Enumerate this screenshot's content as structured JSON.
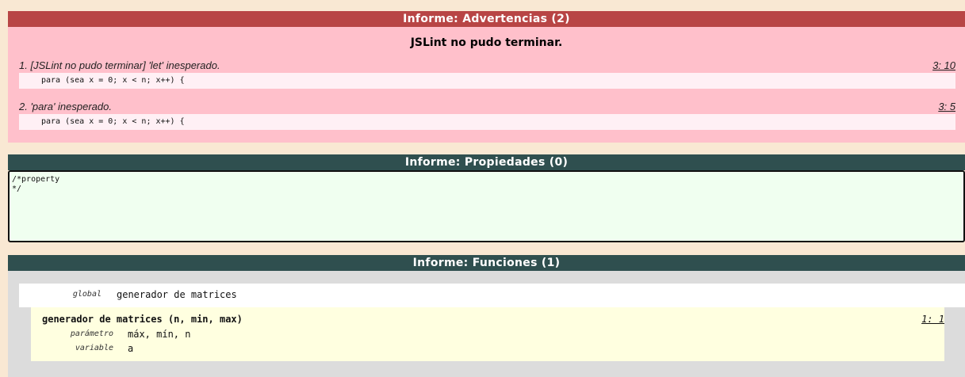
{
  "warnings": {
    "header": "Informe: Advertencias (2)",
    "title": "JSLint no pudo terminar.",
    "items": [
      {
        "message": "1. [JSLint no pudo terminar] 'let' inesperado.",
        "location": "3: 10",
        "code": "para (sea x = 0; x < n; x++) {"
      },
      {
        "message": "2. 'para' inesperado.",
        "location": "3: 5",
        "code": "para (sea x = 0; x < n; x++) {"
      }
    ]
  },
  "properties": {
    "header": "Informe: Propiedades (0)",
    "content": "/*property\n*/"
  },
  "functions": {
    "header": "Informe: Funciones (1)",
    "global_label": "global",
    "global_value": "generador de matrices",
    "function": {
      "signature": "generador de matrices (n, min, max)",
      "location": "1: 1",
      "rows": [
        {
          "label": "parámetro",
          "value": "máx, mín, n"
        },
        {
          "label": "variable",
          "value": "a"
        }
      ]
    }
  },
  "colors": {
    "warning_header": "#b84545",
    "dark_header": "#2f4f4f",
    "warning_bg": "#ffc0cb",
    "properties_bg": "#f0fff0",
    "function_bg": "#ffffe0",
    "page_bg": "#f9e8d3"
  }
}
